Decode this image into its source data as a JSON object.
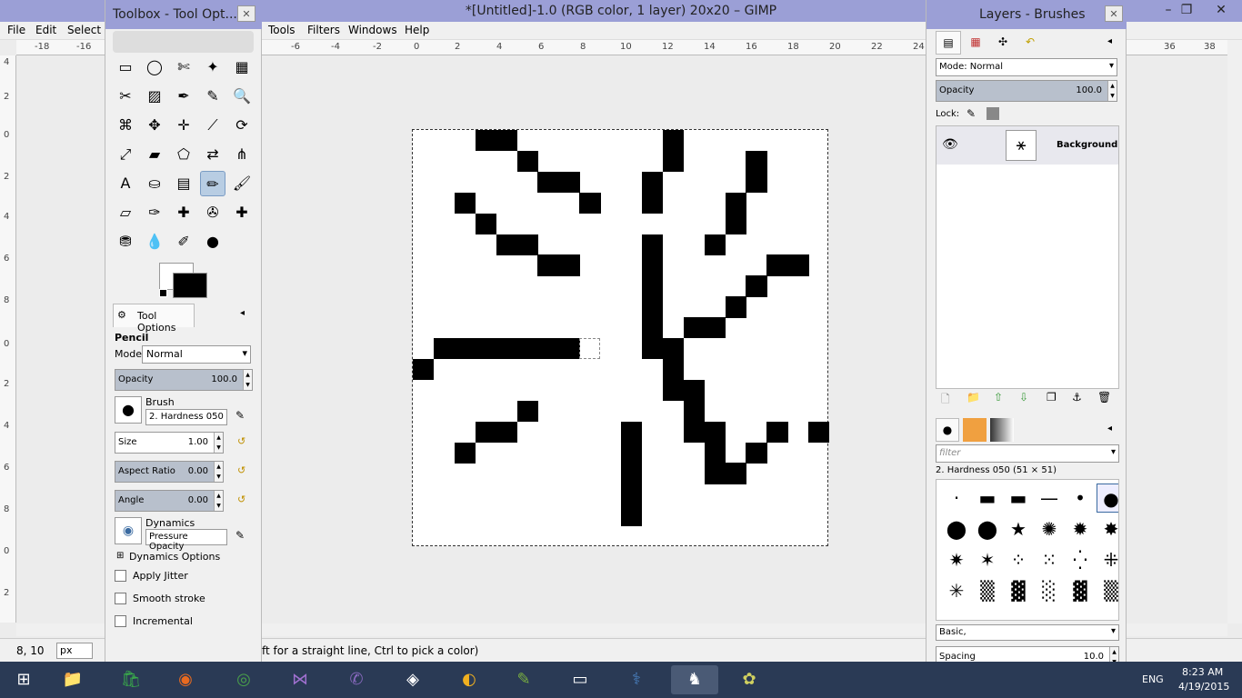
{
  "window": {
    "title": "*[Untitled]-1.0 (RGB color, 1 layer) 20x20 – GIMP"
  },
  "menus": [
    "File",
    "Edit",
    "Select",
    "Tools",
    "Filters",
    "Windows",
    "Help"
  ],
  "rulers": {
    "h_ticks": [
      "-18",
      "-16",
      "-6",
      "-4",
      "-2",
      "0",
      "2",
      "4",
      "6",
      "8",
      "10",
      "12",
      "14",
      "16",
      "18",
      "20",
      "22",
      "24",
      "36",
      "38"
    ],
    "v_ticks": [
      "4",
      "2",
      "0",
      "2",
      "4",
      "6",
      "8",
      "0",
      "2",
      "4",
      "6",
      "8",
      "0",
      "2"
    ]
  },
  "status": {
    "coords": "8, 10",
    "unit": "px",
    "message": "ft for a straight line, Ctrl to pick a color)"
  },
  "toolbox": {
    "title": "Toolbox - Tool Opt...",
    "tool_options_tab": "Tool Options",
    "tool_name": "Pencil",
    "mode_label": "Mode:",
    "mode_value": "Normal",
    "opacity_label": "Opacity",
    "opacity_value": "100.0",
    "brush_label": "Brush",
    "brush_value": "2. Hardness 050",
    "size_label": "Size",
    "size_value": "1.00",
    "aspect_label": "Aspect Ratio",
    "aspect_value": "0.00",
    "angle_label": "Angle",
    "angle_value": "0.00",
    "dynamics_label": "Dynamics",
    "dynamics_value": "Pressure Opacity",
    "dynamics_options": "Dynamics Options",
    "apply_jitter": "Apply Jitter",
    "smooth_stroke": "Smooth stroke",
    "incremental": "Incremental"
  },
  "layers": {
    "title": "Layers - Brushes",
    "mode_label": "Mode: Normal",
    "opacity_label": "Opacity",
    "opacity_value": "100.0",
    "lock_label": "Lock:",
    "layer_name": "Background",
    "filter_placeholder": "filter",
    "brush_info": "2. Hardness 050 (51 × 51)",
    "brush_set": "Basic,",
    "spacing_label": "Spacing",
    "spacing_value": "10.0"
  },
  "taskbar": {
    "lang": "ENG",
    "time": "8:23 AM",
    "date": "4/19/2015"
  }
}
